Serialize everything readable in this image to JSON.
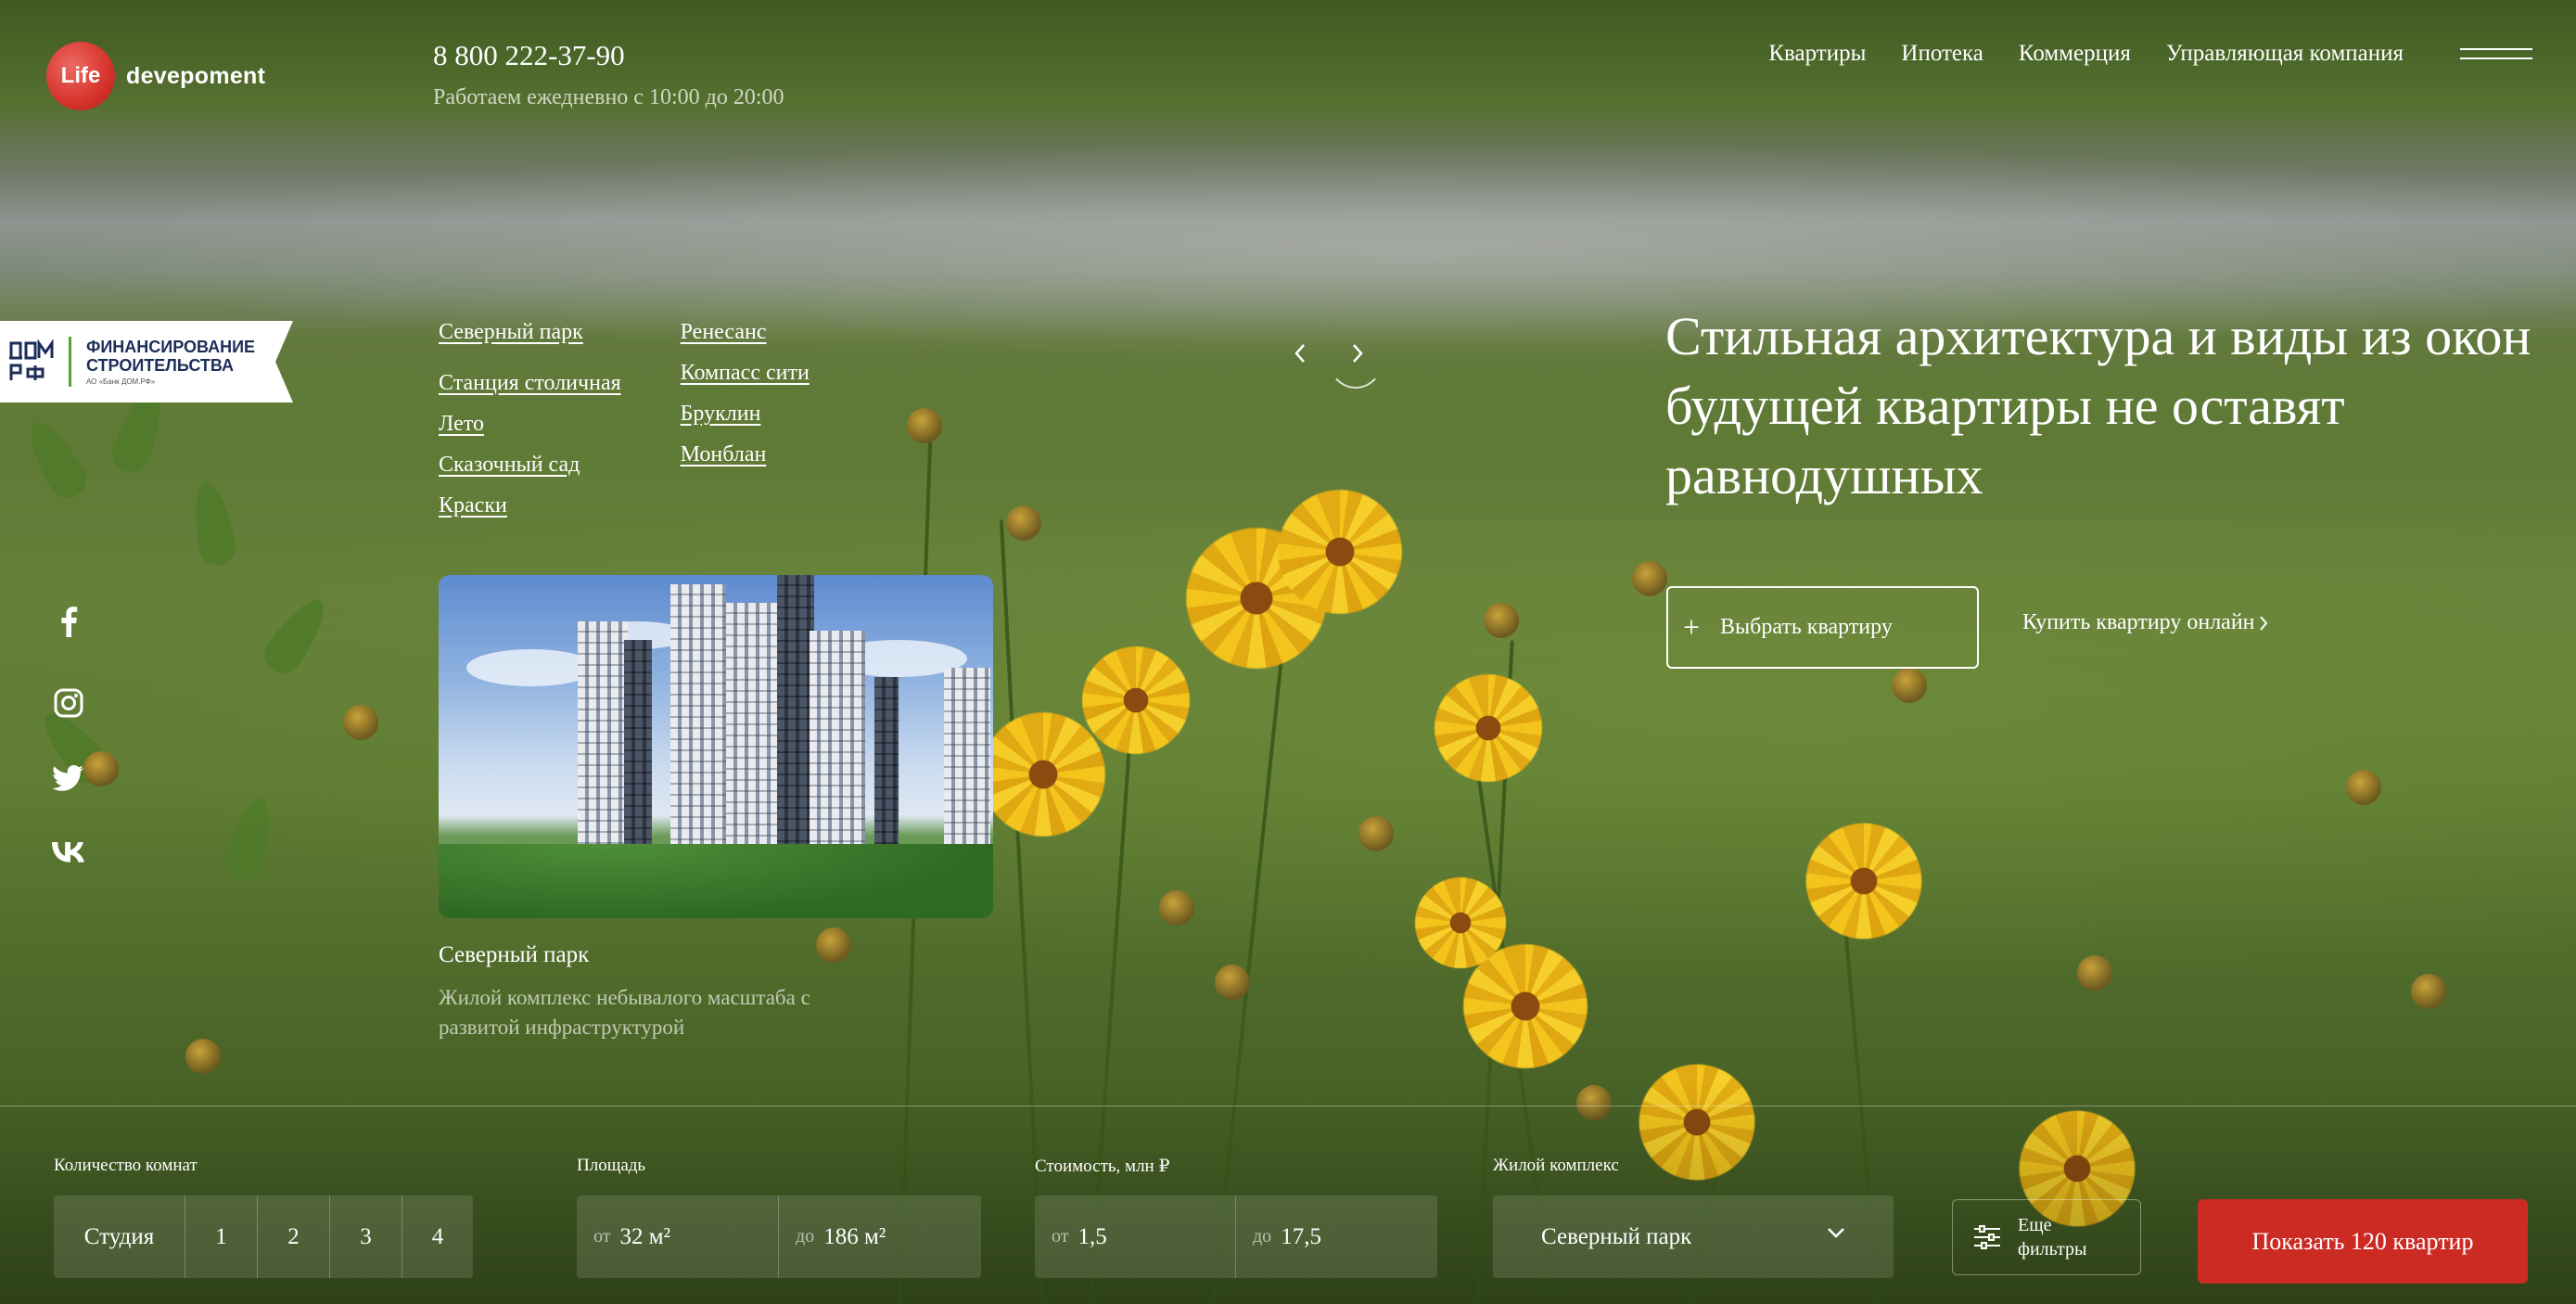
{
  "brand": {
    "logo_circle_text": "Life",
    "logo_text": "devepoment",
    "accent_color": "#d6332b"
  },
  "contact": {
    "phone": "8 800 222-37-90",
    "hours": "Работаем ежедневно с 10:00 до 20:00"
  },
  "nav": {
    "items": [
      "Квартиры",
      "Ипотека",
      "Коммерция",
      "Управляющая компания"
    ],
    "menu_icon": "hamburger-icon"
  },
  "financing_badge": {
    "title_line1": "ФИНАНСИРОВАНИЕ",
    "title_line2": "СТРОИТЕЛЬСТВА",
    "subtitle": "АО «Банк ДОМ.РФ»",
    "logo_text": "ДОМ.РФ"
  },
  "socials": [
    "facebook-icon",
    "instagram-icon",
    "twitter-icon",
    "vk-icon"
  ],
  "projects": {
    "col1": [
      "Северный парк",
      "Станция столичная",
      "Лето",
      "Сказочный сад",
      "Краски"
    ],
    "col2": [
      "Ренесанс",
      "Компасс сити",
      "Бруклин",
      "Монблан"
    ]
  },
  "slider": {
    "prev_icon": "chevron-left-icon",
    "next_icon": "chevron-right-icon"
  },
  "card": {
    "title": "Северный парк",
    "description": "Жилой комплекс небывалого масштаба с развитой инфраструктурой"
  },
  "hero": {
    "line1": "Стильная архитектура и виды из окон",
    "line2": "будущей квартиры не оставят",
    "line3": "равнодушных",
    "choose_button": "Выбрать квартиру",
    "buy_online_link": "Купить квартиру онлайн"
  },
  "filters": {
    "rooms": {
      "label": "Количество комнат",
      "options": [
        "Студия",
        "1",
        "2",
        "3",
        "4"
      ]
    },
    "area": {
      "label": "Площадь",
      "from_prefix": "от",
      "from_value": "32 м²",
      "to_prefix": "до",
      "to_value": "186 м²"
    },
    "price": {
      "label": "Стоимость, млн ₽",
      "from_prefix": "от",
      "from_value": "1,5",
      "to_prefix": "до",
      "to_value": "17,5"
    },
    "complex": {
      "label": "Жилой комплекс",
      "selected": "Северный парк"
    },
    "more_filters": {
      "line1": "Еще",
      "line2": "фильтры"
    },
    "submit": "Показать 120 квартир"
  }
}
